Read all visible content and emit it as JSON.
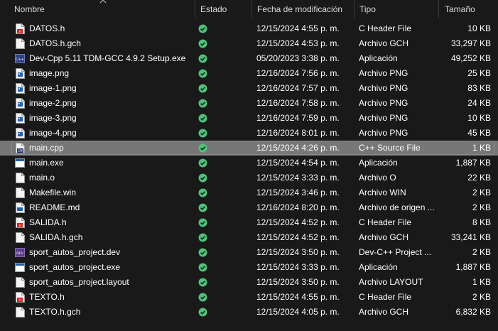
{
  "columns": {
    "name": "Nombre",
    "state": "Estado",
    "date": "Fecha de modificación",
    "type": "Tipo",
    "size": "Tamaño"
  },
  "colors": {
    "background": "#191919",
    "selected_row": "#777777",
    "synced_status": "#4ec27a",
    "icon_red": "#d72020",
    "icon_blue": "#1f5fb8"
  },
  "files": [
    {
      "name": "DATOS.h",
      "date": "12/15/2024 4:55 p. m.",
      "type": "C Header File",
      "size": "10 KB",
      "icon": "header-file-icon",
      "selected": false
    },
    {
      "name": "DATOS.h.gch",
      "date": "12/15/2024 4:53 p. m.",
      "type": "Archivo GCH",
      "size": "33,297 KB",
      "icon": "generic-file-icon",
      "selected": false
    },
    {
      "name": "Dev-Cpp 5.11 TDM-GCC 4.9.2 Setup.exe",
      "date": "05/20/2023 3:38 p. m.",
      "type": "Aplicación",
      "size": "49,252 KB",
      "icon": "installer-icon",
      "selected": false
    },
    {
      "name": "image.png",
      "date": "12/16/2024 7:56 p. m.",
      "type": "Archivo PNG",
      "size": "25 KB",
      "icon": "png-file-icon",
      "selected": false
    },
    {
      "name": "image-1.png",
      "date": "12/16/2024 7:57 p. m.",
      "type": "Archivo PNG",
      "size": "83 KB",
      "icon": "png-file-icon",
      "selected": false
    },
    {
      "name": "image-2.png",
      "date": "12/16/2024 7:58 p. m.",
      "type": "Archivo PNG",
      "size": "24 KB",
      "icon": "png-file-icon",
      "selected": false
    },
    {
      "name": "image-3.png",
      "date": "12/16/2024 7:59 p. m.",
      "type": "Archivo PNG",
      "size": "10 KB",
      "icon": "png-file-icon",
      "selected": false
    },
    {
      "name": "image-4.png",
      "date": "12/16/2024 8:01 p. m.",
      "type": "Archivo PNG",
      "size": "45 KB",
      "icon": "png-file-icon",
      "selected": false
    },
    {
      "name": "main.cpp",
      "date": "12/15/2024 4:26 p. m.",
      "type": "C++ Source File",
      "size": "1 KB",
      "icon": "cpp-file-icon",
      "selected": true
    },
    {
      "name": "main.exe",
      "date": "12/15/2024 4:54 p. m.",
      "type": "Aplicación",
      "size": "1,887 KB",
      "icon": "exe-file-icon",
      "selected": false
    },
    {
      "name": "main.o",
      "date": "12/15/2024 3:33 p. m.",
      "type": "Archivo O",
      "size": "22 KB",
      "icon": "generic-file-icon",
      "selected": false
    },
    {
      "name": "Makefile.win",
      "date": "12/15/2024 3:46 p. m.",
      "type": "Archivo WIN",
      "size": "2 KB",
      "icon": "generic-file-icon",
      "selected": false
    },
    {
      "name": "README.md",
      "date": "12/16/2024 8:20 p. m.",
      "type": "Archivo de origen ...",
      "size": "2 KB",
      "icon": "markdown-file-icon",
      "selected": false
    },
    {
      "name": "SALIDA.h",
      "date": "12/15/2024 4:52 p. m.",
      "type": "C Header File",
      "size": "8 KB",
      "icon": "header-file-icon",
      "selected": false
    },
    {
      "name": "SALIDA.h.gch",
      "date": "12/15/2024 4:52 p. m.",
      "type": "Archivo GCH",
      "size": "33,241 KB",
      "icon": "generic-file-icon",
      "selected": false
    },
    {
      "name": "sport_autos_project.dev",
      "date": "12/15/2024 3:50 p. m.",
      "type": "Dev-C++ Project ...",
      "size": "2 KB",
      "icon": "dev-project-icon",
      "selected": false
    },
    {
      "name": "sport_autos_project.exe",
      "date": "12/15/2024 3:33 p. m.",
      "type": "Aplicación",
      "size": "1,887 KB",
      "icon": "exe-file-icon",
      "selected": false
    },
    {
      "name": "sport_autos_project.layout",
      "date": "12/15/2024 3:50 p. m.",
      "type": "Archivo LAYOUT",
      "size": "1 KB",
      "icon": "generic-file-icon",
      "selected": false
    },
    {
      "name": "TEXTO.h",
      "date": "12/15/2024 4:55 p. m.",
      "type": "C Header File",
      "size": "2 KB",
      "icon": "header-file-icon",
      "selected": false
    },
    {
      "name": "TEXTO.h.gch",
      "date": "12/15/2024 4:05 p. m.",
      "type": "Archivo GCH",
      "size": "6,832 KB",
      "icon": "generic-file-icon",
      "selected": false
    }
  ]
}
